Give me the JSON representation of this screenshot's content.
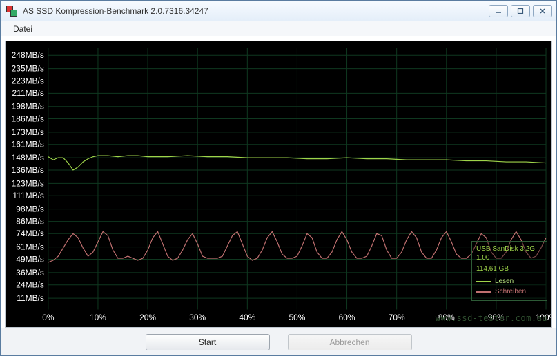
{
  "window": {
    "title": "AS SSD Kompression-Benchmark 2.0.7316.34247"
  },
  "menubar": {
    "file_label": "Datei"
  },
  "buttons": {
    "start_label": "Start",
    "cancel_label": "Abbrechen"
  },
  "legend": {
    "device_line1": "USB  SanDisk 3.2G",
    "device_line2": "1.00",
    "capacity": "114,61 GB",
    "read_label": "Lesen",
    "write_label": "Schreiben"
  },
  "watermark": {
    "text": "www.ssd-tester.com.au"
  },
  "chart_data": {
    "type": "line",
    "xlabel": "",
    "ylabel": "",
    "x_unit": "%",
    "y_unit": "MB/s",
    "xlim": [
      0,
      100
    ],
    "ylim": [
      0,
      255
    ],
    "x_ticks": [
      0,
      10,
      20,
      30,
      40,
      50,
      60,
      70,
      80,
      90,
      100
    ],
    "y_ticks": [
      11,
      24,
      36,
      49,
      61,
      74,
      86,
      98,
      111,
      123,
      136,
      148,
      161,
      173,
      186,
      198,
      211,
      223,
      235,
      248
    ],
    "series": [
      {
        "name": "Lesen",
        "color": "#9fd44a",
        "x": [
          0,
          1,
          2,
          3,
          4,
          5,
          6,
          7,
          8,
          9,
          10,
          12,
          14,
          16,
          18,
          20,
          24,
          28,
          32,
          36,
          40,
          44,
          48,
          52,
          56,
          60,
          64,
          68,
          72,
          76,
          80,
          84,
          88,
          92,
          96,
          100
        ],
        "values": [
          149,
          146,
          148,
          148,
          143,
          136,
          139,
          144,
          147,
          149,
          150,
          150,
          149,
          150,
          150,
          149,
          149,
          150,
          149,
          149,
          148,
          148,
          148,
          147,
          147,
          148,
          147,
          147,
          146,
          146,
          146,
          145,
          145,
          144,
          144,
          143
        ]
      },
      {
        "name": "Schreiben",
        "color": "#c07070",
        "x": [
          0,
          1,
          2,
          3,
          4,
          5,
          6,
          7,
          8,
          9,
          10,
          11,
          12,
          13,
          14,
          15,
          16,
          17,
          18,
          19,
          20,
          21,
          22,
          23,
          24,
          25,
          26,
          27,
          28,
          29,
          30,
          31,
          32,
          33,
          34,
          35,
          36,
          37,
          38,
          39,
          40,
          41,
          42,
          43,
          44,
          45,
          46,
          47,
          48,
          49,
          50,
          51,
          52,
          53,
          54,
          55,
          56,
          57,
          58,
          59,
          60,
          61,
          62,
          63,
          64,
          65,
          66,
          67,
          68,
          69,
          70,
          71,
          72,
          73,
          74,
          75,
          76,
          77,
          78,
          79,
          80,
          81,
          82,
          83,
          84,
          85,
          86,
          87,
          88,
          89,
          90,
          91,
          92,
          93,
          94,
          95,
          96,
          97,
          98,
          99,
          100
        ],
        "values": [
          46,
          48,
          52,
          60,
          68,
          74,
          70,
          60,
          52,
          56,
          66,
          76,
          72,
          58,
          50,
          50,
          52,
          50,
          48,
          50,
          58,
          70,
          76,
          64,
          52,
          48,
          50,
          58,
          68,
          74,
          64,
          52,
          50,
          50,
          50,
          52,
          62,
          72,
          76,
          64,
          52,
          48,
          50,
          58,
          70,
          76,
          66,
          54,
          50,
          50,
          52,
          62,
          74,
          70,
          56,
          50,
          50,
          56,
          68,
          76,
          68,
          56,
          50,
          50,
          52,
          62,
          74,
          72,
          58,
          50,
          50,
          56,
          68,
          76,
          70,
          56,
          50,
          50,
          58,
          70,
          76,
          66,
          54,
          50,
          50,
          54,
          64,
          74,
          70,
          56,
          50,
          50,
          56,
          68,
          76,
          68,
          56,
          50,
          52,
          60,
          70
        ]
      }
    ]
  }
}
